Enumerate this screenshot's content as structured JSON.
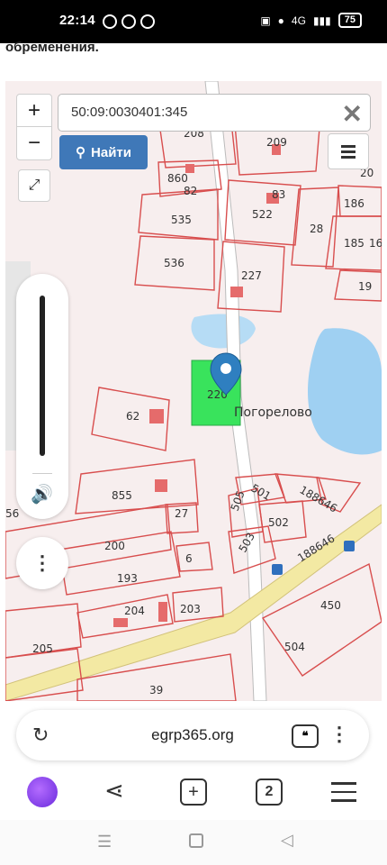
{
  "status_bar": {
    "time": "22:14",
    "signal_text": "4G",
    "battery": "75"
  },
  "page": {
    "partial_text": "обременения"
  },
  "map": {
    "search_value": "50:09:0030401:345",
    "find_label": "Найти",
    "zoom_in": "+",
    "zoom_out": "−",
    "place_name": "Погорелово",
    "parcel_labels": [
      "208",
      "209",
      "860",
      "82",
      "535",
      "522",
      "83",
      "28",
      "186",
      "185",
      "20",
      "19",
      "16",
      "536",
      "227",
      "62",
      "220",
      "855",
      "27",
      "200",
      "56",
      "193",
      "6",
      "204",
      "203",
      "205",
      "39",
      "450",
      "504",
      "505",
      "503",
      "502",
      "501",
      "188646"
    ],
    "colors": {
      "selected_parcel": "#39e35c",
      "marker": "#2f7fc0",
      "water": "#9fd0f2",
      "road": "#f3e9a3",
      "parcel_border": "#d84e4e"
    }
  },
  "browser": {
    "url": "egrp365.org",
    "tab_count": "2"
  }
}
